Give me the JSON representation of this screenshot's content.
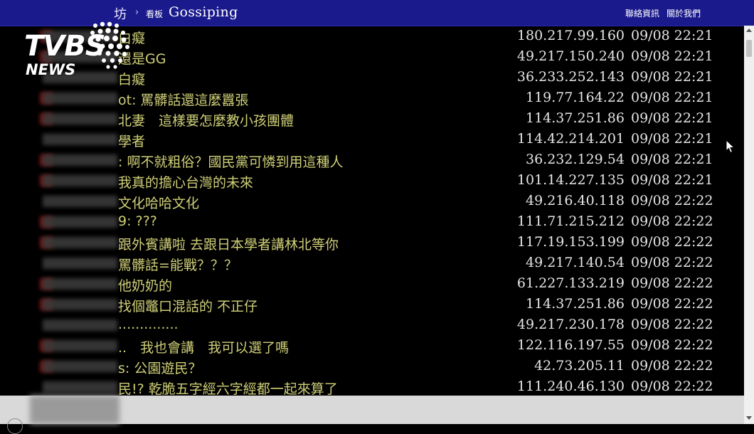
{
  "header": {
    "breadcrumb_tail": "坊",
    "board_label": "看板",
    "board_name": "Gossiping",
    "nav_right": [
      "聯絡資訊",
      "關於我們"
    ]
  },
  "logo": {
    "main": "TVBS",
    "sub": "NEWS"
  },
  "comments": [
    {
      "message": "白癡",
      "ip": "180.217.99.160",
      "datetime": "09/08 22:21"
    },
    {
      "message": "還是GG",
      "ip": "49.217.150.240",
      "datetime": "09/08 22:21"
    },
    {
      "message": "白癡",
      "ip": "36.233.252.143",
      "datetime": "09/08 22:21"
    },
    {
      "message": "ot: 罵髒話還這麼囂張",
      "ip": "119.77.164.22",
      "datetime": "09/08 22:21"
    },
    {
      "message": "北妻　這樣要怎麼教小孩團體",
      "ip": "114.37.251.86",
      "datetime": "09/08 22:21"
    },
    {
      "message": "學者",
      "ip": "114.42.214.201",
      "datetime": "09/08 22:21"
    },
    {
      "message": ": 啊不就粗俗？國民黨可憐到用這種人",
      "ip": "36.232.129.54",
      "datetime": "09/08 22:21"
    },
    {
      "message": "我真的擔心台灣的未來",
      "ip": "101.14.227.135",
      "datetime": "09/08 22:21"
    },
    {
      "message": "文化哈哈文化",
      "ip": "49.216.40.118",
      "datetime": "09/08 22:22"
    },
    {
      "message": "9: ???",
      "ip": "111.71.215.212",
      "datetime": "09/08 22:22"
    },
    {
      "message": "跟外賓講啦 去跟日本學者講林北等你",
      "ip": "117.19.153.199",
      "datetime": "09/08 22:22"
    },
    {
      "message": "罵髒話=能戰？？？",
      "ip": "49.217.140.54",
      "datetime": "09/08 22:22"
    },
    {
      "message": "他奶奶的",
      "ip": "61.227.133.219",
      "datetime": "09/08 22:22"
    },
    {
      "message": "找個鼈口混話的 不正仔",
      "ip": "114.37.251.86",
      "datetime": "09/08 22:22"
    },
    {
      "message": "..............",
      "ip": "49.217.230.178",
      "datetime": "09/08 22:22"
    },
    {
      "message": "..　我也會講　我可以選了嗎",
      "ip": "122.116.197.55",
      "datetime": "09/08 22:22"
    },
    {
      "message": "s: 公園遊民？",
      "ip": "42.73.205.11",
      "datetime": "09/08 22:22"
    },
    {
      "message": "民!? 乾脆五字經六字經都一起來算了",
      "ip": "111.240.46.130",
      "datetime": "09/08 22:22"
    }
  ],
  "icons": {
    "scroll_up": "arrow-up-icon",
    "scroll_down": "arrow-down-icon",
    "cursor": "mouse-pointer-icon"
  },
  "colors": {
    "header_bg": "#1a1a8c",
    "comment_text": "#cfcf78",
    "meta_text": "#e6e6e6",
    "background": "#000000"
  }
}
